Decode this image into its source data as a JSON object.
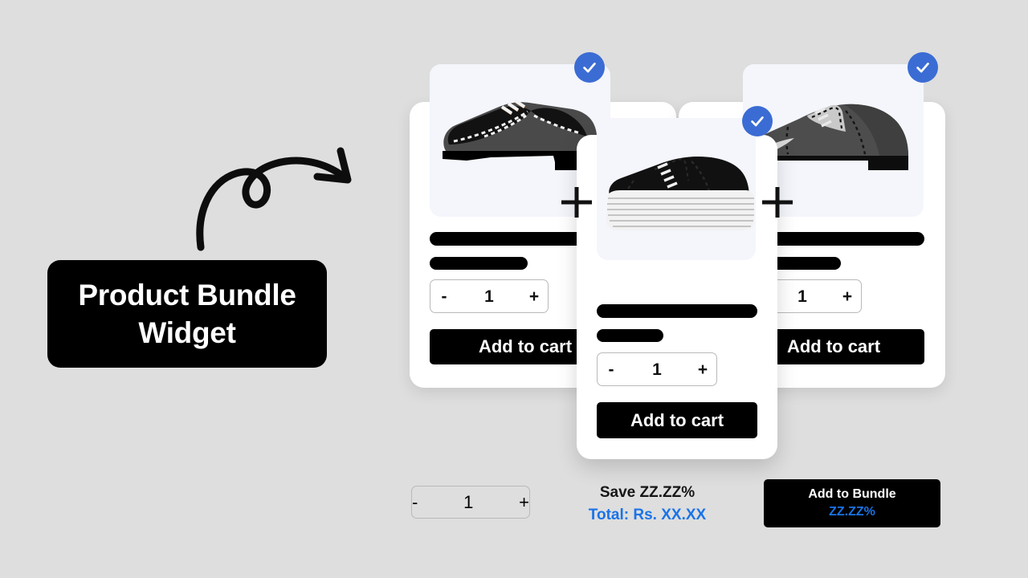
{
  "page": {
    "background_color": "#dedede",
    "accent_blue": "#3b6cd4",
    "link_blue": "#1a73e8"
  },
  "annotation": {
    "arrow_icon": "curly-arrow-right-icon",
    "label": "Product Bundle Widget"
  },
  "separators": [
    {
      "icon": "plus-icon"
    },
    {
      "icon": "plus-icon"
    }
  ],
  "products": [
    {
      "id": "product-1",
      "image_icon": "black-brogue-dress-shoe",
      "selected": true,
      "check_icon": "check-circle-icon",
      "title_redacted": true,
      "price_redacted": true,
      "quantity": "1",
      "decrement_label": "-",
      "increment_label": "+",
      "add_label": "Add to cart"
    },
    {
      "id": "product-2",
      "image_icon": "black-platform-sneaker",
      "selected": true,
      "check_icon": "check-circle-icon",
      "title_redacted": true,
      "price_redacted": true,
      "quantity": "1",
      "decrement_label": "-",
      "increment_label": "+",
      "add_label": "Add to cart"
    },
    {
      "id": "product-3",
      "image_icon": "gray-captoe-oxford-shoe",
      "selected": true,
      "check_icon": "check-circle-icon",
      "title_redacted": true,
      "price_redacted": true,
      "quantity": "1",
      "decrement_label": "-",
      "increment_label": "+",
      "add_label": "Add to cart"
    }
  ],
  "bundle_bar": {
    "quantity": "1",
    "decrement_label": "-",
    "increment_label": "+",
    "save_text": "Save ZZ.ZZ%",
    "total_text": "Total: Rs. XX.XX",
    "button_label": "Add to Bundle",
    "button_sublabel": "ZZ.ZZ%"
  }
}
